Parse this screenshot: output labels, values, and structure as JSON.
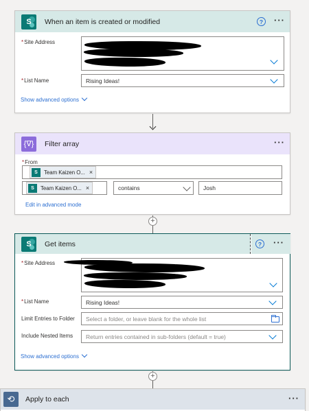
{
  "trigger": {
    "title": "When an item is created or modified",
    "help": "?",
    "more": "···",
    "site_address_label": "Site Address",
    "list_name_label": "List Name",
    "list_name_value": "Rising Ideas!",
    "advanced_link": "Show advanced options"
  },
  "filter": {
    "title": "Filter array",
    "icon_text": "{∇}",
    "more": "···",
    "from_label": "From",
    "from_token": "Team Kaizen O...",
    "condition_token": "Team Kaizen O...",
    "operator": "contains",
    "value": "Josh",
    "advanced_link": "Edit in advanced mode"
  },
  "get_items": {
    "title": "Get items",
    "help": "?",
    "more": "···",
    "site_address_label": "Site Address",
    "list_name_label": "List Name",
    "list_name_value": "Rising Ideas!",
    "limit_label": "Limit Entries to Folder",
    "limit_placeholder": "Select a folder, or leave blank for the whole list",
    "nested_label": "Include Nested Items",
    "nested_placeholder": "Return entries contained in sub-folders (default = true)",
    "advanced_link": "Show advanced options"
  },
  "apply_each": {
    "title": "Apply to each",
    "more": "···"
  },
  "icons": {
    "sharepoint": "sharepoint-icon",
    "filter": "filter-array-icon",
    "loop": "loop-icon",
    "folder": "folder-icon"
  },
  "colors": {
    "sharepoint_header": "#d6e9e7",
    "filter_header": "#eae3fb",
    "apply_header": "#dde3ea",
    "link": "#2c6fd1",
    "required": "#a4262c"
  }
}
